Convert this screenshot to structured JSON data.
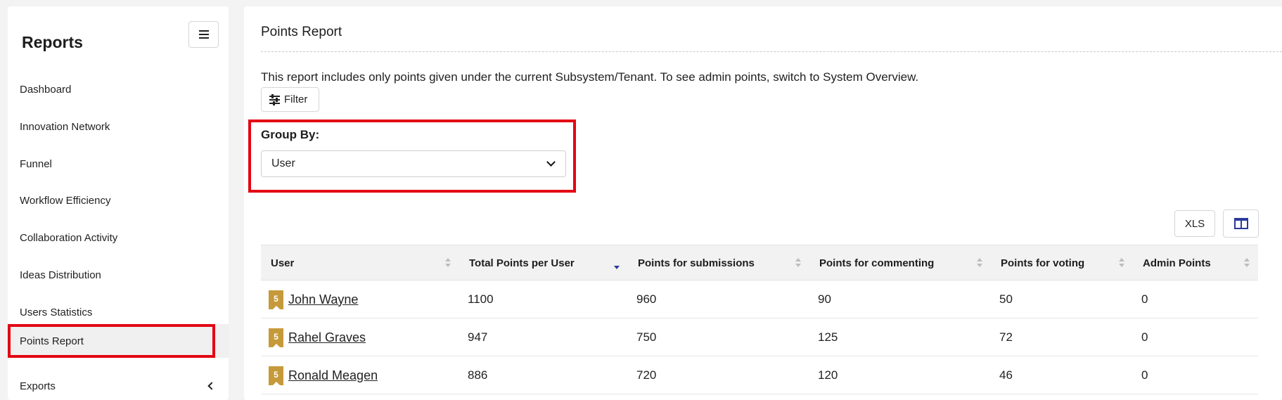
{
  "sidebar": {
    "title": "Reports",
    "items": [
      {
        "label": "Dashboard"
      },
      {
        "label": "Innovation Network"
      },
      {
        "label": "Funnel"
      },
      {
        "label": "Workflow Efficiency"
      },
      {
        "label": "Collaboration Activity"
      },
      {
        "label": "Ideas Distribution"
      },
      {
        "label": "Users Statistics"
      },
      {
        "label": "Points Report",
        "active": true
      },
      {
        "label": "Exports"
      }
    ]
  },
  "main": {
    "title": "Points Report",
    "info": "This report includes only points given under the current Subsystem/Tenant. To see admin points, switch to System Overview.",
    "filter_label": "Filter",
    "group_by": {
      "label": "Group By:",
      "selected": "User"
    },
    "export_label": "XLS",
    "table": {
      "headers": [
        "User",
        "Total Points per User",
        "Points for submissions",
        "Points for commenting",
        "Points for voting",
        "Admin Points"
      ],
      "rows": [
        {
          "badge": "5",
          "user": "John Wayne",
          "total": "1100",
          "submissions": "960",
          "commenting": "90",
          "voting": "50",
          "admin": "0"
        },
        {
          "badge": "5",
          "user": "Rahel Graves",
          "total": "947",
          "submissions": "750",
          "commenting": "125",
          "voting": "72",
          "admin": "0"
        },
        {
          "badge": "5",
          "user": "Ronald Meagen",
          "total": "886",
          "submissions": "720",
          "commenting": "120",
          "voting": "46",
          "admin": "0"
        }
      ]
    }
  },
  "colors": {
    "highlight": "#e30613",
    "badge": "#c69a3a",
    "accent": "#2b3a9c"
  }
}
